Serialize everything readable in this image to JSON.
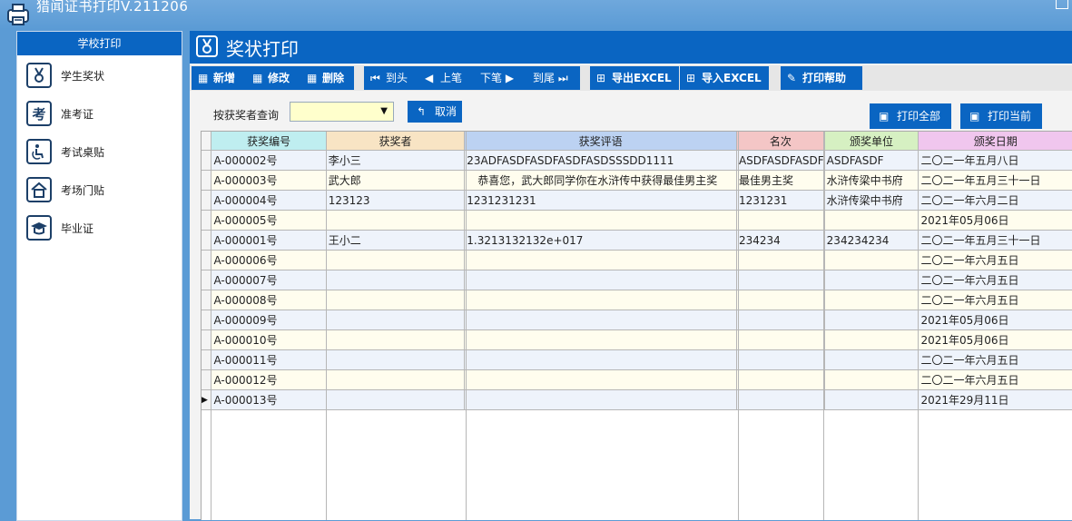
{
  "app": {
    "title": "猎闻证书打印V.211206"
  },
  "sidebar": {
    "header": "学校打印",
    "items": [
      {
        "label": "学生奖状",
        "icon": "medal-icon"
      },
      {
        "label": "准考证",
        "icon": "exam-icon",
        "glyph": "考"
      },
      {
        "label": "考试桌贴",
        "icon": "desk-icon"
      },
      {
        "label": "考场门贴",
        "icon": "house-icon"
      },
      {
        "label": "毕业证",
        "icon": "graduation-cap-icon"
      }
    ]
  },
  "panel": {
    "title": "奖状打印"
  },
  "toolbar": {
    "add": "新增",
    "edit": "修改",
    "delete": "删除",
    "first": "到头",
    "prev": "上笔",
    "next": "下笔",
    "last": "到尾",
    "export": "导出EXCEL",
    "import": "导入EXCEL",
    "help": "打印帮助"
  },
  "search": {
    "label": "按获奖者查询",
    "value": "",
    "cancel": "取消"
  },
  "actions": {
    "print_all": "打印全部",
    "print_current": "打印当前"
  },
  "table": {
    "columns": [
      "获奖编号",
      "获奖者",
      "获奖评语",
      "名次",
      "颁奖单位",
      "颁奖日期"
    ],
    "header_colors": [
      "#bfeef0",
      "#f8e4c4",
      "#bcd2f2",
      "#f4c6c6",
      "#d6f0c2",
      "#f0c6ee"
    ],
    "rows": [
      [
        "A-000002号",
        "李小三",
        "23ADFASDFASDFASDFASDSSSDD1111",
        "ASDFASDFASDF",
        "ASDFASDF",
        "二〇二一年五月八日"
      ],
      [
        "A-000003号",
        "武大郎",
        "　恭喜您，武大郎同学你在水浒传中获得最佳男主奖",
        "最佳男主奖",
        "水浒传梁中书府",
        "二〇二一年五月三十一日"
      ],
      [
        "A-000004号",
        "123123",
        "1231231231",
        "1231231",
        "水浒传梁中书府",
        "二〇二一年六月二日"
      ],
      [
        "A-000005号",
        "",
        "",
        "",
        "",
        "2021年05月06日"
      ],
      [
        "A-000001号",
        "王小二",
        "1.3213132132e+017",
        "234234",
        "234234234",
        "二〇二一年五月三十一日"
      ],
      [
        "A-000006号",
        "",
        "",
        "",
        "",
        "二〇二一年六月五日"
      ],
      [
        "A-000007号",
        "",
        "",
        "",
        "",
        "二〇二一年六月五日"
      ],
      [
        "A-000008号",
        "",
        "",
        "",
        "",
        "二〇二一年六月五日"
      ],
      [
        "A-000009号",
        "",
        "",
        "",
        "",
        "2021年05月06日"
      ],
      [
        "A-000010号",
        "",
        "",
        "",
        "",
        "2021年05月06日"
      ],
      [
        "A-000011号",
        "",
        "",
        "",
        "",
        "二〇二一年六月五日"
      ],
      [
        "A-000012号",
        "",
        "",
        "",
        "",
        "二〇二一年六月五日"
      ],
      [
        "A-000013号",
        "",
        "",
        "",
        "",
        "2021年29月11日"
      ]
    ],
    "current_row": 12
  }
}
